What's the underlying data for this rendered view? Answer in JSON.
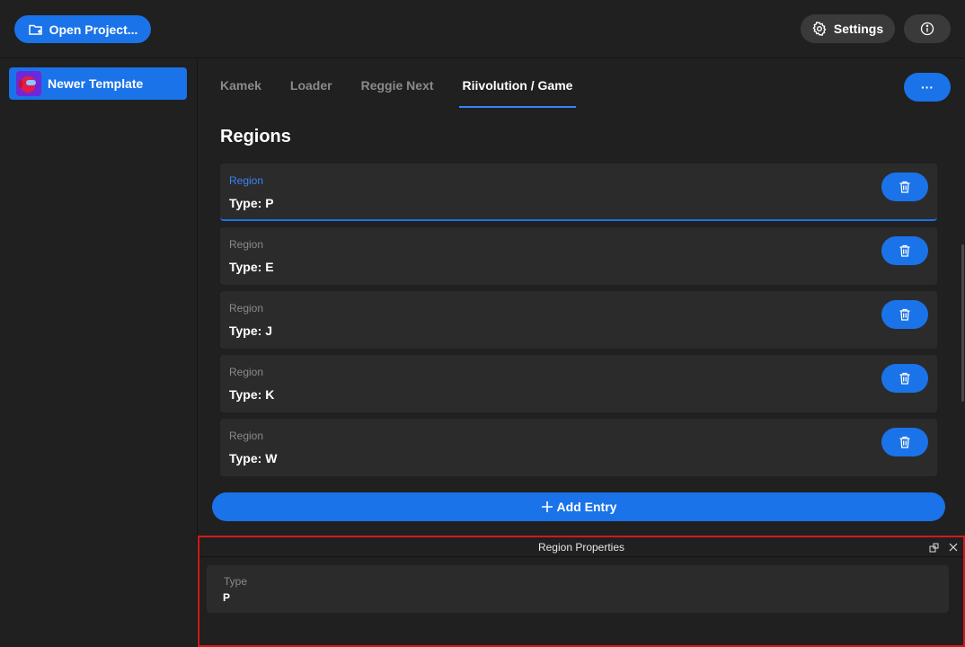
{
  "header": {
    "open_project_label": "Open Project...",
    "settings_label": "Settings"
  },
  "sidebar": {
    "items": [
      {
        "label": "Newer Template"
      }
    ]
  },
  "main": {
    "tabs": [
      {
        "label": "Kamek"
      },
      {
        "label": "Loader"
      },
      {
        "label": "Reggie Next"
      },
      {
        "label": "Riivolution / Game"
      }
    ],
    "active_tab": "Riivolution / Game",
    "more_label": "···",
    "section_title": "Regions",
    "entries": [
      {
        "label": "Region",
        "value": "Type: P"
      },
      {
        "label": "Region",
        "value": "Type: E"
      },
      {
        "label": "Region",
        "value": "Type: J"
      },
      {
        "label": "Region",
        "value": "Type: K"
      },
      {
        "label": "Region",
        "value": "Type: W"
      }
    ],
    "add_entry_label": "Add Entry"
  },
  "properties": {
    "title": "Region Properties",
    "field_label": "Type",
    "field_value": "P"
  },
  "colors": {
    "accent": "#1a73e8",
    "panel_border": "#d11a1a"
  }
}
